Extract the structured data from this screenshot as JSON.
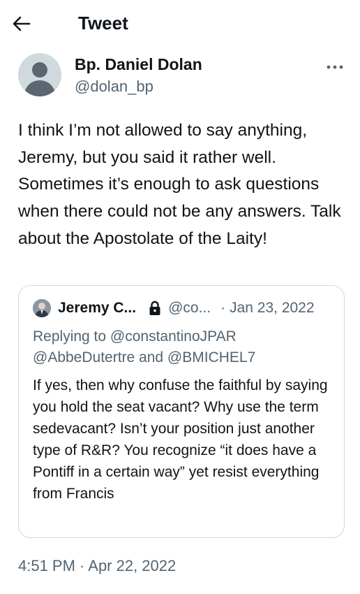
{
  "header": {
    "title": "Tweet",
    "back_icon": "arrow-left-icon"
  },
  "tweet": {
    "author": {
      "display_name": "Bp. Daniel Dolan",
      "handle": "@dolan_bp",
      "avatar_icon": "default-avatar-icon"
    },
    "more_icon": "more-options-icon",
    "text": "I think I’m not allowed to say anything, Jeremy, but you said it rather well. Sometimes it’s enough to ask questions when there could not be any answers. Talk about the Apostolate of the Laity!",
    "timestamp": "4:51 PM · Apr 22, 2022"
  },
  "quoted_tweet": {
    "author": {
      "display_name": "Jeremy C...",
      "handle": "@co...",
      "protected_icon": "lock-icon"
    },
    "separator": "·",
    "date": "Jan 23, 2022",
    "replying_to_line1": "Replying to @constantinoJPAR",
    "replying_to_line2": "@AbbeDutertre and @BMICHEL7",
    "text": "If yes, then why confuse the faithful by saying you hold the seat vacant? Why use the term sedevacant? Isn’t your position just another type of R&R? You recognize “it does have a Pontiff in a certain way” yet resist everything from Francis"
  },
  "colors": {
    "primary_text": "#0f1419",
    "secondary_text": "#536471",
    "border": "#cfd9de",
    "avatar_bg": "#cfd9de"
  }
}
